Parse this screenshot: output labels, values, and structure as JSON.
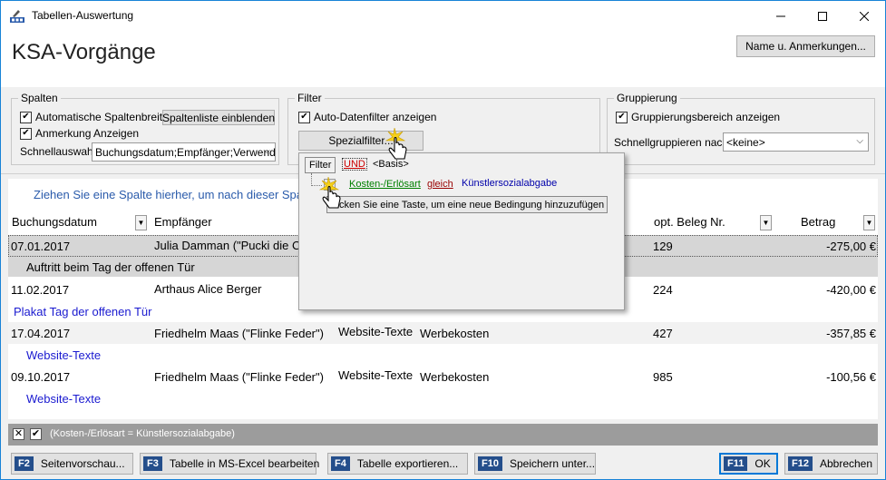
{
  "window": {
    "title": "Tabellen-Auswertung"
  },
  "header": {
    "page_title": "KSA-Vorgänge",
    "name_button": "Name u. Anmerkungen..."
  },
  "spalten": {
    "legend": "Spalten",
    "auto_width": "Automatische Spaltenbreite",
    "list_button": "Spaltenliste einblenden",
    "show_note": "Anmerkung Anzeigen",
    "quick_label": "Schnellauswahl:",
    "quick_value": "Buchungsdatum;Empfänger;Verwendu"
  },
  "filter": {
    "legend": "Filter",
    "auto_filter": "Auto-Datenfilter anzeigen",
    "special_button": "Spezialfilter..."
  },
  "gruppierung": {
    "legend": "Gruppierung",
    "show_area": "Gruppierungsbereich anzeigen",
    "quick_label": "Schnellgruppieren nach:",
    "quick_value": "<keine>"
  },
  "grid": {
    "group_hint": "Ziehen Sie eine Spalte hierher, um nach dieser Spa",
    "columns": {
      "date": "Buchungsdatum",
      "recipient": "Empfänger",
      "beleg": "opt. Beleg Nr.",
      "amount": "Betrag"
    },
    "rows": [
      {
        "date": "07.01.2017",
        "recipient": "Julia Damman (\"Pucki die Cl",
        "purpose": "",
        "category": "",
        "beleg": "129",
        "amount": "-275,00 €",
        "note": "Auftritt beim Tag der offenen Tür"
      },
      {
        "date": "11.02.2017",
        "recipient": "Arthaus Alice Berger",
        "purpose": "",
        "category": "",
        "beleg": "224",
        "amount": "-420,00 €",
        "note": "Plakat Tag der offenen Tür"
      },
      {
        "date": "17.04.2017",
        "recipient": "Friedhelm Maas (\"Flinke Feder\")",
        "purpose": "Website-Texte",
        "category": "Werbekosten",
        "beleg": "427",
        "amount": "-357,85 €",
        "note": "Website-Texte"
      },
      {
        "date": "09.10.2017",
        "recipient": "Friedhelm Maas (\"Flinke Feder\")",
        "purpose": "Website-Texte",
        "category": "Werbekosten",
        "beleg": "985",
        "amount": "-100,56 €",
        "note": "Website-Texte"
      }
    ]
  },
  "filter_bar": {
    "text": "(Kosten-/Erlösart = Künstlersozialabgabe)"
  },
  "popup": {
    "tab": "Filter",
    "und": "UND",
    "basis": "<Basis>",
    "field": "Kosten-/Erlösart",
    "op": "gleich",
    "value": "Künstlersozialabgabe",
    "hint": "Klicken Sie eine Taste, um eine neue Bedingung hinzuzufügen",
    "hint_visible": "cken Sie eine Taste, um eine neue Bedingung hinzuzufügen"
  },
  "buttons": {
    "preview": {
      "key": "F2",
      "label": "Seitenvorschau..."
    },
    "excel": {
      "key": "F3",
      "label": "Tabelle in MS-Excel bearbeiten"
    },
    "export": {
      "key": "F4",
      "label": "Tabelle exportieren..."
    },
    "save": {
      "key": "F10",
      "label": "Speichern unter..."
    },
    "ok": {
      "key": "F11",
      "label": "OK"
    },
    "cancel": {
      "key": "F12",
      "label": "Abbrechen"
    }
  },
  "colors": {
    "accent": "#244e8b",
    "link": "#1a1ad0",
    "hint": "#2a5bab",
    "und": "#cc0000",
    "field": "#008000"
  }
}
